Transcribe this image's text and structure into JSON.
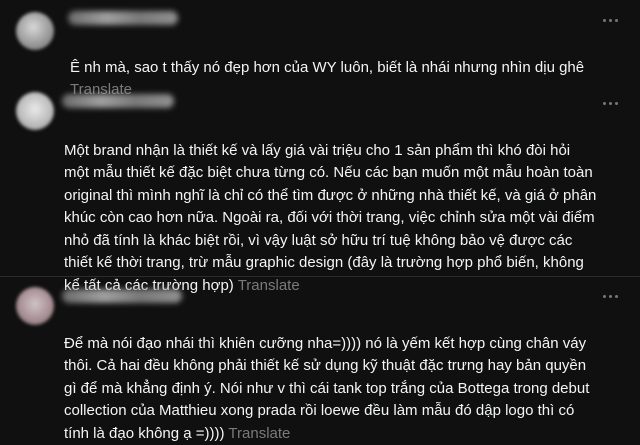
{
  "comments": [
    {
      "text": "Ê nh mà, sao t thấy nó đẹp hơn của WY luôn, biết là nhái nhưng nhìn dịu ghê",
      "translate_label": "Translate"
    },
    {
      "text": "Một brand nhận là thiết kế và lấy giá vài triệu cho 1 sản phẩm thì khó đòi hỏi\nmột mẫu thiết kế đặc biệt chưa từng có. Nếu các bạn muốn một mẫu hoàn toàn\noriginal thì mình nghĩ là chỉ có thể tìm được ở những nhà thiết kế, và giá ở phân\nkhúc còn cao hơn nữa. Ngoài ra, đối với thời trang, việc chỉnh sửa một vài điểm\nnhỏ đã tính là khác biệt rồi, vì vậy luật sở hữu trí tuệ không bảo vệ được các\nthiết kế thời trang, trừ mẫu graphic design (đây là trường hợp phổ biến, không\nkể tất cả các trường hợp)",
      "translate_label": "Translate"
    },
    {
      "text": "Để mà nói đạo nhái thì khiên cưỡng nha=)))) nó là yếm kết hợp cùng chân váy\nthôi. Cả hai đều không phải thiết kế sử dụng kỹ thuật đặc trưng hay bản quyền\ngì để mà khẳng định ý. Nói như v thì cái tank top trắng của Bottega trong debut\ncollection của Matthieu xong prada rồi loewe đều làm mẫu đó dập logo thì có\ntính là đạo không ạ =))))",
      "translate_label": "Translate"
    }
  ],
  "colors": {
    "background": "#101010",
    "text": "#f3f5f7",
    "muted": "#7a7a7a",
    "divider": "#2c2c2c"
  },
  "icons": {
    "more": "more-horizontal-icon",
    "avatar": "avatar"
  }
}
